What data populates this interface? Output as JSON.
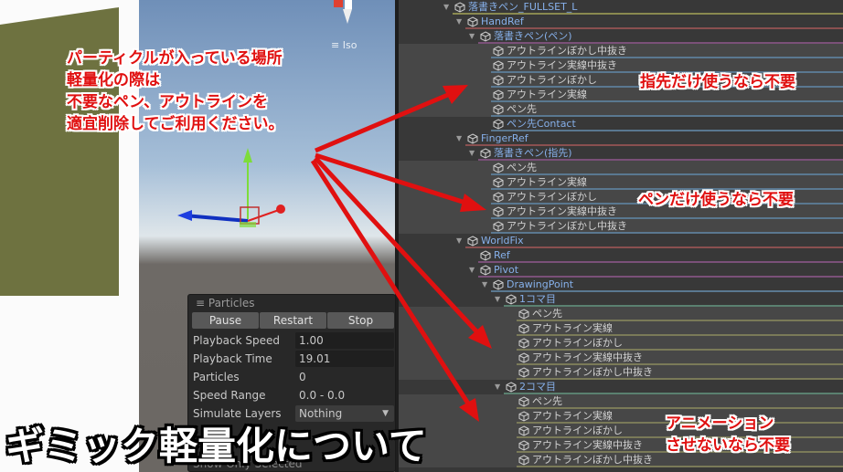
{
  "viewport": {
    "projection_label": "≡ Iso"
  },
  "hierarchy": {
    "rows": [
      {
        "label": "落書きペン_FULLSET_L",
        "level": 0,
        "arrow": true,
        "blue": true,
        "leaf": false,
        "line": "#8a8a50"
      },
      {
        "label": "HandRef",
        "level": 1,
        "arrow": true,
        "blue": true,
        "leaf": false,
        "line": "#8a5050"
      },
      {
        "label": "落書きペン(ペン)",
        "level": 2,
        "arrow": true,
        "blue": true,
        "leaf": false,
        "line": "#7a5078"
      },
      {
        "label": "アウトラインぼかし中抜き",
        "level": 3,
        "leaf": true,
        "line": "#5a7890"
      },
      {
        "label": "アウトライン実線中抜き",
        "level": 3,
        "leaf": true,
        "line": "#5a7890"
      },
      {
        "label": "アウトラインぼかし",
        "level": 3,
        "leaf": true,
        "line": "#5a7890"
      },
      {
        "label": "アウトライン実線",
        "level": 3,
        "leaf": true,
        "line": "#5a7890"
      },
      {
        "label": "ペン先",
        "level": 3,
        "leaf": true,
        "line": "#5a7890"
      },
      {
        "label": "ペン先Contact",
        "level": 3,
        "blue": true,
        "leaf": false,
        "line": "#5a7890"
      },
      {
        "label": "FingerRef",
        "level": 1,
        "arrow": true,
        "blue": true,
        "leaf": false,
        "line": "#8a5050"
      },
      {
        "label": "落書きペン(指先)",
        "level": 2,
        "arrow": true,
        "blue": true,
        "leaf": false,
        "line": "#7a5078"
      },
      {
        "label": "ペン先",
        "level": 3,
        "leaf": true,
        "line": "#5a7890"
      },
      {
        "label": "アウトライン実線",
        "level": 3,
        "leaf": true,
        "line": "#5a7890"
      },
      {
        "label": "アウトラインぼかし",
        "level": 3,
        "leaf": true,
        "line": "#5a7890"
      },
      {
        "label": "アウトライン実線中抜き",
        "level": 3,
        "leaf": true,
        "line": "#5a7890"
      },
      {
        "label": "アウトラインぼかし中抜き",
        "level": 3,
        "leaf": true,
        "line": "#5a7890"
      },
      {
        "label": "WorldFix",
        "level": 1,
        "arrow": true,
        "blue": true,
        "leaf": false,
        "line": "#8a5050"
      },
      {
        "label": "Ref",
        "level": 2,
        "blue": true,
        "leaf": false,
        "line": "#7a5078"
      },
      {
        "label": "Pivot",
        "level": 2,
        "arrow": true,
        "blue": true,
        "leaf": false,
        "line": "#7a5078"
      },
      {
        "label": "DrawingPoint",
        "level": 3,
        "arrow": true,
        "blue": true,
        "leaf": false,
        "line": "#5a7890"
      },
      {
        "label": "1コマ目",
        "level": 4,
        "arrow": true,
        "blue": true,
        "leaf": false,
        "line": "#5a8070"
      },
      {
        "label": "ペン先",
        "level": 5,
        "leaf": true,
        "line": "#7a7a58"
      },
      {
        "label": "アウトライン実線",
        "level": 5,
        "leaf": true,
        "line": "#7a7a58"
      },
      {
        "label": "アウトラインぼかし",
        "level": 5,
        "leaf": true,
        "line": "#7a7a58"
      },
      {
        "label": "アウトライン実線中抜き",
        "level": 5,
        "leaf": true,
        "line": "#7a7a58"
      },
      {
        "label": "アウトラインぼかし中抜き",
        "level": 5,
        "leaf": true,
        "line": "#7a7a58"
      },
      {
        "label": "2コマ目",
        "level": 4,
        "arrow": true,
        "blue": true,
        "leaf": false,
        "line": "#5a8070"
      },
      {
        "label": "ペン先",
        "level": 5,
        "leaf": true,
        "line": "#7a7a58"
      },
      {
        "label": "アウトライン実線",
        "level": 5,
        "leaf": true,
        "line": "#7a7a58"
      },
      {
        "label": "アウトラインぼかし",
        "level": 5,
        "leaf": true,
        "line": "#7a7a58"
      },
      {
        "label": "アウトライン実線中抜き",
        "level": 5,
        "leaf": true,
        "line": "#7a7a58"
      },
      {
        "label": "アウトラインぼかし中抜き",
        "level": 5,
        "leaf": true,
        "line": "#7a7a58"
      }
    ]
  },
  "particles": {
    "title": "Particles",
    "buttons": [
      "Pause",
      "Restart",
      "Stop"
    ],
    "fields": [
      {
        "label": "Playback Speed",
        "value": "1.00",
        "type": "field"
      },
      {
        "label": "Playback Time",
        "value": "19.01",
        "type": "field"
      },
      {
        "label": "Particles",
        "value": "0",
        "type": "text"
      },
      {
        "label": "Speed Range",
        "value": "0.0 - 0.0",
        "type": "text"
      },
      {
        "label": "Simulate Layers",
        "value": "Nothing",
        "type": "dropdown"
      }
    ],
    "show_only_selected": "Show Only Selected"
  },
  "annotations": {
    "main": [
      "パーティクルが入っている場所",
      "軽量化の際は",
      "不要なペン、アウトラインを",
      "適宜削除してご利用ください。"
    ],
    "fingertip": "指先だけ使うなら不要",
    "pen": "ペンだけ使うなら不要",
    "animation": [
      "アニメーション",
      "させないなら不要"
    ]
  },
  "title": "ギミック軽量化について",
  "colors": {
    "annotation": "#e01010",
    "hierarchy_bg": "#383838",
    "prefab_text": "#86b0ea"
  }
}
